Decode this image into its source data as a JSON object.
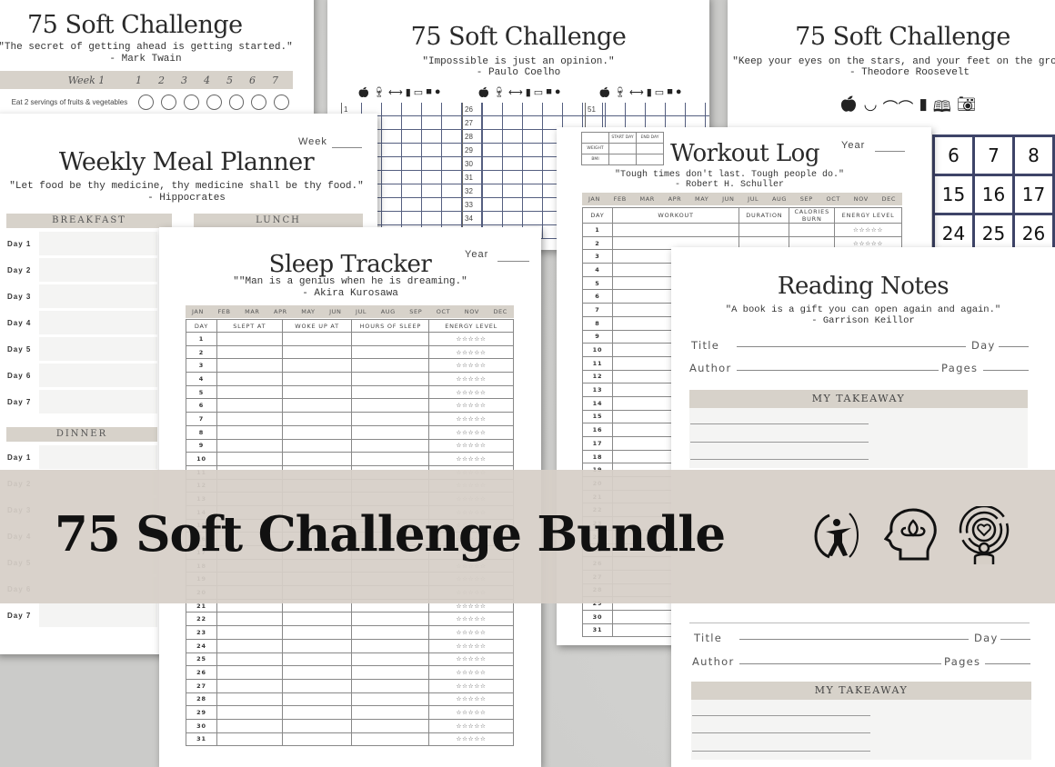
{
  "challenge_week": {
    "title": "75 Soft Challenge",
    "quote": "\"The secret of getting ahead is getting started.\"",
    "author": "- Mark Twain",
    "week_label": "Week 1",
    "days": [
      "1",
      "2",
      "3",
      "4",
      "5",
      "6",
      "7"
    ],
    "habit": "Eat 2 servings of fruits & vegetables"
  },
  "challenge_grid": {
    "title": "75 Soft Challenge",
    "quote": "\"Impossible is just an opinion.\"",
    "author": "- Paulo Coelho",
    "icons": [
      "apple-icon",
      "glass-icon",
      "walk-icon",
      "cup-icon",
      "book-icon",
      "camera-icon",
      "lock-icon"
    ],
    "col1_start": "1",
    "col2_days": [
      "26",
      "27",
      "28",
      "29",
      "30",
      "31",
      "32",
      "33",
      "34"
    ],
    "col3_start": "51"
  },
  "challenge_calendar": {
    "title": "75 Soft Challenge",
    "quote": "\"Keep your eyes on the stars, and your feet on the ground.\"",
    "author": "- Theodore Roosevelt",
    "icons": [
      "apple-icon",
      "bowl-icon",
      "walk-icon",
      "cup-icon",
      "book-icon",
      "camera-icon"
    ],
    "cells": [
      "6",
      "7",
      "8",
      "",
      "15",
      "16",
      "17",
      "",
      "24",
      "25",
      "26",
      ""
    ]
  },
  "meal_planner": {
    "week_label": "Week",
    "title": "Weekly Meal Planner",
    "quote": "\"Let food be thy medicine, thy medicine shall be thy food.\"",
    "author": "- Hippocrates",
    "sections": [
      "BREAKFAST",
      "LUNCH",
      "DINNER"
    ],
    "days": [
      "Day 1",
      "Day 2",
      "Day 3",
      "Day 4",
      "Day 5",
      "Day 6",
      "Day 7"
    ]
  },
  "sleep_tracker": {
    "year_label": "Year",
    "title": "Sleep Tracker",
    "quote": "\"\"Man is a genius when he is dreaming.\"",
    "author": "- Akira Kurosawa",
    "months": [
      "JAN",
      "FEB",
      "MAR",
      "APR",
      "MAY",
      "JUN",
      "JUL",
      "AUG",
      "SEP",
      "OCT",
      "NOV",
      "DEC"
    ],
    "columns": [
      "DAY",
      "SLEPT AT",
      "WOKE UP AT",
      "HOURS OF SLEEP",
      "ENERGY LEVEL"
    ],
    "stars": "☆☆☆☆☆"
  },
  "workout_log": {
    "mini_table": {
      "headers": [
        "",
        "START DAY",
        "END DAY"
      ],
      "rows": [
        "WEIGHT",
        "BMI"
      ]
    },
    "title": "Workout Log",
    "year_label": "Year",
    "quote": "\"Tough times don't last. Tough people do.\"",
    "author": "- Robert H. Schuller",
    "months": [
      "JAN",
      "FEB",
      "MAR",
      "APR",
      "MAY",
      "JUN",
      "JUL",
      "AUG",
      "SEP",
      "OCT",
      "NOV",
      "DEC"
    ],
    "columns": [
      "DAY",
      "WORKOUT",
      "DURATION",
      "CALORIES BURN",
      "ENERGY LEVEL"
    ],
    "stars": "☆☆☆☆☆"
  },
  "reading_notes": {
    "title": "Reading Notes",
    "quote": "\"A book is a gift you can open again and again.\"",
    "author": "- Garrison Keillor",
    "fields": {
      "title": "Title",
      "day": "Day",
      "author": "Author",
      "pages": "Pages"
    },
    "takeaway": "MY TAKEAWAY"
  },
  "banner": {
    "title": "75 Soft Challenge Bundle",
    "icons": [
      "archer-fitness-icon",
      "mind-lotus-icon",
      "self-love-icon"
    ]
  }
}
